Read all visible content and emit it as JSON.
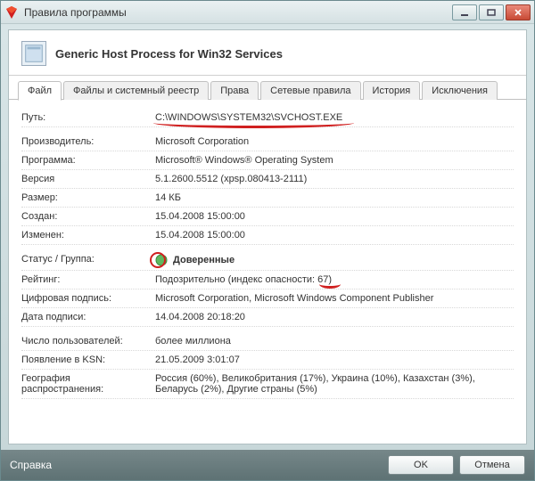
{
  "window": {
    "title": "Правила программы"
  },
  "header": {
    "title": "Generic Host Process for Win32 Services"
  },
  "tabs": [
    {
      "label": "Файл"
    },
    {
      "label": "Файлы и системный реестр"
    },
    {
      "label": "Права"
    },
    {
      "label": "Сетевые правила"
    },
    {
      "label": "История"
    },
    {
      "label": "Исключения"
    }
  ],
  "rows": {
    "path": {
      "label": "Путь:",
      "value": "C:\\WINDOWS\\SYSTEM32\\SVCHOST.EXE"
    },
    "vendor": {
      "label": "Производитель:",
      "value": "Microsoft Corporation"
    },
    "program": {
      "label": "Программа:",
      "value": "Microsoft® Windows® Operating System"
    },
    "version": {
      "label": "Версия",
      "value": "5.1.2600.5512 (xpsp.080413-2111)"
    },
    "size": {
      "label": "Размер:",
      "value": "14 КБ"
    },
    "created": {
      "label": "Создан:",
      "value": "15.04.2008 15:00:00"
    },
    "modified": {
      "label": "Изменен:",
      "value": "15.04.2008 15:00:00"
    },
    "status": {
      "label": "Статус / Группа:",
      "value": "Доверенные"
    },
    "rating": {
      "label": "Рейтинг:",
      "value": "Подозрительно (индекс опасности: 67)"
    },
    "signature": {
      "label": "Цифровая подпись:",
      "value": "Microsoft Corporation, Microsoft Windows Component Publisher"
    },
    "signdate": {
      "label": "Дата подписи:",
      "value": "14.04.2008 20:18:20"
    },
    "users": {
      "label": "Число пользователей:",
      "value": "более миллиона"
    },
    "ksn": {
      "label": "Появление в KSN:",
      "value": "21.05.2009 3:01:07"
    },
    "geo": {
      "label": "География распространения:",
      "value": "Россия (60%), Великобритания (17%), Украина (10%), Казахстан (3%), Беларусь (2%), Другие страны (5%)"
    }
  },
  "footer": {
    "help": "Справка",
    "ok": "OK",
    "cancel": "Отмена"
  }
}
